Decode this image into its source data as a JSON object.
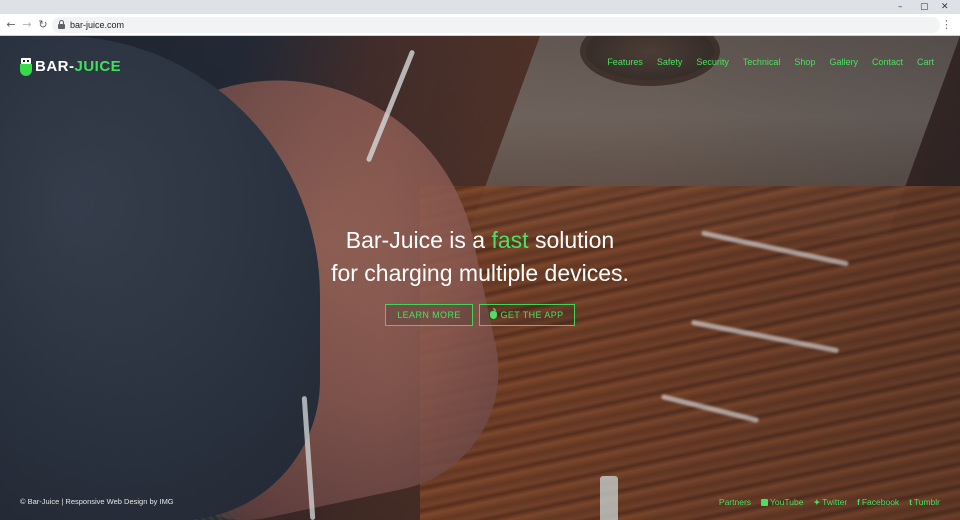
{
  "browser": {
    "url": "bar-juice.com",
    "controls": {
      "minimize": "–",
      "restore": "▢",
      "close": "✕"
    }
  },
  "site": {
    "logo": {
      "part1": "BAR-",
      "part2": "JUICE"
    },
    "nav": [
      "Features",
      "Safety",
      "Security",
      "Technical",
      "Shop",
      "Gallery",
      "Contact",
      "Cart"
    ],
    "headline": {
      "pre": "Bar-Juice is a ",
      "highlight": "fast",
      "post": " solution",
      "line2": "for charging multiple devices."
    },
    "buttons": {
      "learn_more": "LEARN MORE",
      "get_app": "GET THE APP"
    },
    "footer": {
      "copyright": "© Bar-Juice | Responsive Web Design by IMG",
      "links": [
        "Partners",
        "YouTube",
        "Twitter",
        "Facebook",
        "Tumblr"
      ]
    }
  },
  "colors": {
    "accent": "#4be064",
    "text": "#ffffff"
  }
}
